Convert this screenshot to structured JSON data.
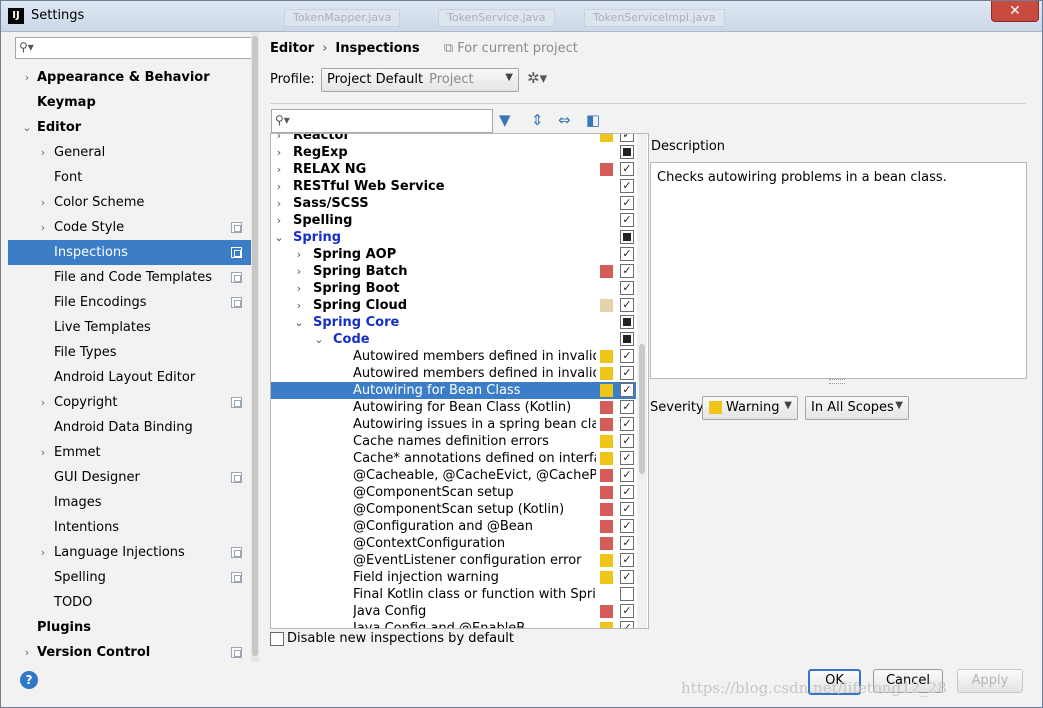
{
  "window": {
    "title": "Settings",
    "app_icon": "IJ",
    "close": "✕",
    "bg_tabs": [
      "TokenMapper.java",
      "TokenService.java",
      "TokenServiceImpl.java"
    ]
  },
  "sidebar": {
    "items": [
      {
        "label": "Appearance & Behavior",
        "level": 0,
        "bold": true,
        "arrow": "›",
        "proj": false
      },
      {
        "label": "Keymap",
        "level": 0,
        "bold": true,
        "arrow": "",
        "proj": false
      },
      {
        "label": "Editor",
        "level": 0,
        "bold": true,
        "arrow": "⌄",
        "proj": false
      },
      {
        "label": "General",
        "level": 1,
        "bold": false,
        "arrow": "›",
        "proj": false
      },
      {
        "label": "Font",
        "level": 1,
        "bold": false,
        "arrow": "",
        "proj": false
      },
      {
        "label": "Color Scheme",
        "level": 1,
        "bold": false,
        "arrow": "›",
        "proj": false
      },
      {
        "label": "Code Style",
        "level": 1,
        "bold": false,
        "arrow": "›",
        "proj": true
      },
      {
        "label": "Inspections",
        "level": 1,
        "bold": false,
        "arrow": "",
        "proj": true,
        "selected": true
      },
      {
        "label": "File and Code Templates",
        "level": 1,
        "bold": false,
        "arrow": "",
        "proj": true
      },
      {
        "label": "File Encodings",
        "level": 1,
        "bold": false,
        "arrow": "",
        "proj": true
      },
      {
        "label": "Live Templates",
        "level": 1,
        "bold": false,
        "arrow": "",
        "proj": false
      },
      {
        "label": "File Types",
        "level": 1,
        "bold": false,
        "arrow": "",
        "proj": false
      },
      {
        "label": "Android Layout Editor",
        "level": 1,
        "bold": false,
        "arrow": "",
        "proj": false
      },
      {
        "label": "Copyright",
        "level": 1,
        "bold": false,
        "arrow": "›",
        "proj": true
      },
      {
        "label": "Android Data Binding",
        "level": 1,
        "bold": false,
        "arrow": "",
        "proj": false
      },
      {
        "label": "Emmet",
        "level": 1,
        "bold": false,
        "arrow": "›",
        "proj": false
      },
      {
        "label": "GUI Designer",
        "level": 1,
        "bold": false,
        "arrow": "",
        "proj": true
      },
      {
        "label": "Images",
        "level": 1,
        "bold": false,
        "arrow": "",
        "proj": false
      },
      {
        "label": "Intentions",
        "level": 1,
        "bold": false,
        "arrow": "",
        "proj": false
      },
      {
        "label": "Language Injections",
        "level": 1,
        "bold": false,
        "arrow": "›",
        "proj": true
      },
      {
        "label": "Spelling",
        "level": 1,
        "bold": false,
        "arrow": "",
        "proj": true
      },
      {
        "label": "TODO",
        "level": 1,
        "bold": false,
        "arrow": "",
        "proj": false
      },
      {
        "label": "Plugins",
        "level": 0,
        "bold": true,
        "arrow": "",
        "proj": false
      },
      {
        "label": "Version Control",
        "level": 0,
        "bold": true,
        "arrow": "›",
        "proj": true
      }
    ]
  },
  "breadcrumb": {
    "editor": "Editor",
    "inspections": "Inspections",
    "for_current_project": "For current project"
  },
  "profile": {
    "label": "Profile:",
    "value": "Project Default",
    "scope": "Project"
  },
  "inspections": [
    {
      "label": "Reactor",
      "level": 0,
      "style": "bold",
      "arrow": "›",
      "severity": "#efc51a",
      "check": "checked"
    },
    {
      "label": "RegExp",
      "level": 0,
      "style": "bold",
      "arrow": "›",
      "severity": "",
      "check": "mixed"
    },
    {
      "label": "RELAX NG",
      "level": 0,
      "style": "bold",
      "arrow": "›",
      "severity": "#d55c58",
      "check": "checked"
    },
    {
      "label": "RESTful Web Service",
      "level": 0,
      "style": "bold",
      "arrow": "›",
      "severity": "",
      "check": "checked"
    },
    {
      "label": "Sass/SCSS",
      "level": 0,
      "style": "bold",
      "arrow": "›",
      "severity": "",
      "check": "checked"
    },
    {
      "label": "Spelling",
      "level": 0,
      "style": "bold",
      "arrow": "›",
      "severity": "",
      "check": "checked"
    },
    {
      "label": "Spring",
      "level": 0,
      "style": "blue",
      "arrow": "⌄",
      "severity": "",
      "check": "mixed"
    },
    {
      "label": "Spring AOP",
      "level": 1,
      "style": "bold",
      "arrow": "›",
      "severity": "",
      "check": "checked"
    },
    {
      "label": "Spring Batch",
      "level": 1,
      "style": "bold",
      "arrow": "›",
      "severity": "#d55c58",
      "check": "checked"
    },
    {
      "label": "Spring Boot",
      "level": 1,
      "style": "bold",
      "arrow": "›",
      "severity": "",
      "check": "checked"
    },
    {
      "label": "Spring Cloud",
      "level": 1,
      "style": "bold",
      "arrow": "›",
      "severity": "#e3d3aa",
      "check": "checked"
    },
    {
      "label": "Spring Core",
      "level": 1,
      "style": "blue",
      "arrow": "⌄",
      "severity": "",
      "check": "mixed"
    },
    {
      "label": "Code",
      "level": 2,
      "style": "blue",
      "arrow": "⌄",
      "severity": "",
      "check": "mixed"
    },
    {
      "label": "Autowired members defined in invalid Spr",
      "level": 3,
      "style": "",
      "arrow": "",
      "severity": "#efc51a",
      "check": "checked"
    },
    {
      "label": "Autowired members defined in invalid Spr",
      "level": 3,
      "style": "",
      "arrow": "",
      "severity": "#efc51a",
      "check": "checked"
    },
    {
      "label": "Autowiring for Bean Class",
      "level": 3,
      "style": "",
      "arrow": "",
      "severity": "#efc51a",
      "check": "checked",
      "selected": true
    },
    {
      "label": "Autowiring for Bean Class (Kotlin)",
      "level": 3,
      "style": "",
      "arrow": "",
      "severity": "#d55c58",
      "check": "checked"
    },
    {
      "label": "Autowiring issues in a spring bean class c",
      "level": 3,
      "style": "",
      "arrow": "",
      "severity": "#d55c58",
      "check": "checked"
    },
    {
      "label": "Cache names definition errors",
      "level": 3,
      "style": "",
      "arrow": "",
      "severity": "#efc51a",
      "check": "checked"
    },
    {
      "label": "Cache* annotations defined on interfaces/",
      "level": 3,
      "style": "",
      "arrow": "",
      "severity": "#efc51a",
      "check": "checked"
    },
    {
      "label": "@Cacheable, @CacheEvict, @CachePut, @",
      "level": 3,
      "style": "",
      "arrow": "",
      "severity": "#d55c58",
      "check": "checked"
    },
    {
      "label": "@ComponentScan setup",
      "level": 3,
      "style": "",
      "arrow": "",
      "severity": "#d55c58",
      "check": "checked"
    },
    {
      "label": "@ComponentScan setup (Kotlin)",
      "level": 3,
      "style": "",
      "arrow": "",
      "severity": "#d55c58",
      "check": "checked"
    },
    {
      "label": "@Configuration and @Bean",
      "level": 3,
      "style": "",
      "arrow": "",
      "severity": "#d55c58",
      "check": "checked"
    },
    {
      "label": "@ContextConfiguration",
      "level": 3,
      "style": "",
      "arrow": "",
      "severity": "#d55c58",
      "check": "checked"
    },
    {
      "label": "@EventListener configuration error",
      "level": 3,
      "style": "",
      "arrow": "",
      "severity": "#efc51a",
      "check": "checked"
    },
    {
      "label": "Field injection warning",
      "level": 3,
      "style": "",
      "arrow": "",
      "severity": "#efc51a",
      "check": "checked"
    },
    {
      "label": "Final Kotlin class or function with Spring a",
      "level": 3,
      "style": "",
      "arrow": "",
      "severity": "",
      "check": "unchecked"
    },
    {
      "label": "Java Config",
      "level": 3,
      "style": "",
      "arrow": "",
      "severity": "#d55c58",
      "check": "checked"
    },
    {
      "label": "Java Config and @EnableB",
      "level": 3,
      "style": "",
      "arrow": "",
      "severity": "#efc51a",
      "check": "checked"
    }
  ],
  "description": {
    "label": "Description",
    "text": "Checks autowiring problems in a bean class."
  },
  "severity": {
    "label": "Severity:",
    "value": "Warning",
    "color": "#efc51a",
    "scope": "In All Scopes"
  },
  "disable_new": "Disable new inspections by default",
  "buttons": {
    "ok": "OK",
    "cancel": "Cancel",
    "apply": "Apply",
    "help": "?"
  },
  "watermark": "https://blog.csdn.net/lifetong12_28"
}
